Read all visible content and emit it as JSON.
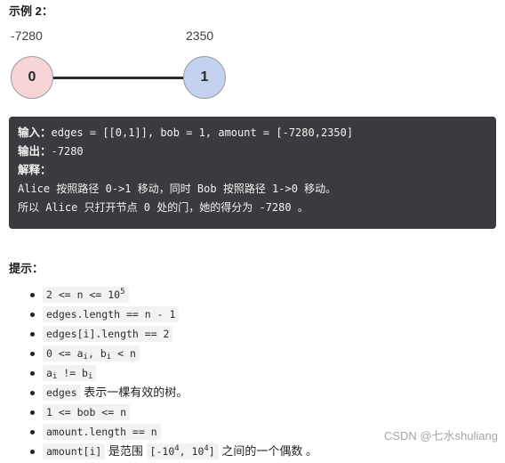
{
  "example": {
    "title": "示例 2："
  },
  "graph": {
    "nodes": [
      {
        "id": "0",
        "label": "0",
        "amount": "-7280",
        "color": "#f6d4d8"
      },
      {
        "id": "1",
        "label": "1",
        "amount": "2350",
        "color": "#c3d3ef"
      }
    ],
    "edges": [
      [
        0,
        1
      ]
    ]
  },
  "code": {
    "input_label": "输入：",
    "input_value": "edges = [[0,1]], bob = 1, amount = [-7280,2350]",
    "output_label": "输出：",
    "output_value": "-7280",
    "explain_label": "解释：",
    "explain_line1": "Alice 按照路径 0->1 移动，同时 Bob 按照路径 1->0 移动。",
    "explain_line2": "所以 Alice 只打开节点 0 处的门，她的得分为 -7280 。"
  },
  "tips": {
    "title": "提示：",
    "items": [
      {
        "code": "2 <= n <= 10",
        "sup": "5",
        "code_tail": "",
        "plain": ""
      },
      {
        "code": "edges.length == n - 1",
        "sup": "",
        "code_tail": "",
        "plain": ""
      },
      {
        "code": "edges[i].length == 2",
        "sup": "",
        "code_tail": "",
        "plain": ""
      },
      {
        "code": "0 <= a",
        "sub": "i",
        "code_mid": ", b",
        "sub2": "i",
        "code_tail": " < n",
        "plain": ""
      },
      {
        "code": "a",
        "sub": "i",
        "code_mid": " != b",
        "sub2": "i",
        "code_tail": "",
        "plain": ""
      },
      {
        "code": "edges",
        "sup": "",
        "code_tail": "",
        "plain": " 表示一棵有效的树。"
      },
      {
        "code": "1 <= bob <= n",
        "sup": "",
        "code_tail": "",
        "plain": ""
      },
      {
        "code": "amount.length == n",
        "sup": "",
        "code_tail": "",
        "plain": ""
      },
      {
        "code": "amount[i]",
        "sup": "",
        "code_tail": "",
        "plain": " 是范围 ",
        "code2": "[-10",
        "sup2": "4",
        "code2_mid": ", 10",
        "sup3": "4",
        "code2_tail": "]",
        "plain2": " 之间的一个偶数 。"
      }
    ]
  },
  "watermark": "CSDN @七水shuliang"
}
